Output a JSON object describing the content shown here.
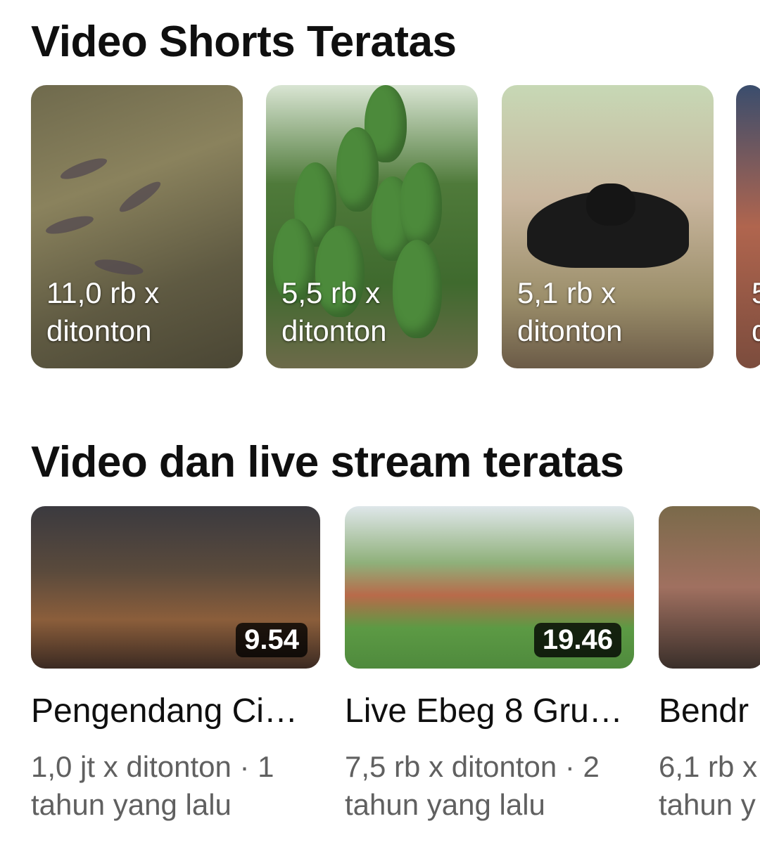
{
  "shorts_section": {
    "title": "Video Shorts Teratas",
    "items": [
      {
        "views": "11,0 rb x\nditonton"
      },
      {
        "views": "5,5 rb x\nditonton"
      },
      {
        "views": "5,1 rb x\nditonton"
      },
      {
        "views": "5\nd"
      }
    ]
  },
  "videos_section": {
    "title": "Video dan live stream teratas",
    "items": [
      {
        "duration": "9.54",
        "title": "Pengendang Ci…",
        "meta": "1,0 jt x ditonton · 1 tahun yang lalu"
      },
      {
        "duration": "19.46",
        "title": "Live Ebeg 8 Gru…",
        "meta": "7,5 rb x ditonton · 2 tahun yang lalu"
      },
      {
        "title": "Bendr",
        "meta": "6,1 rb x\ntahun y"
      }
    ]
  }
}
